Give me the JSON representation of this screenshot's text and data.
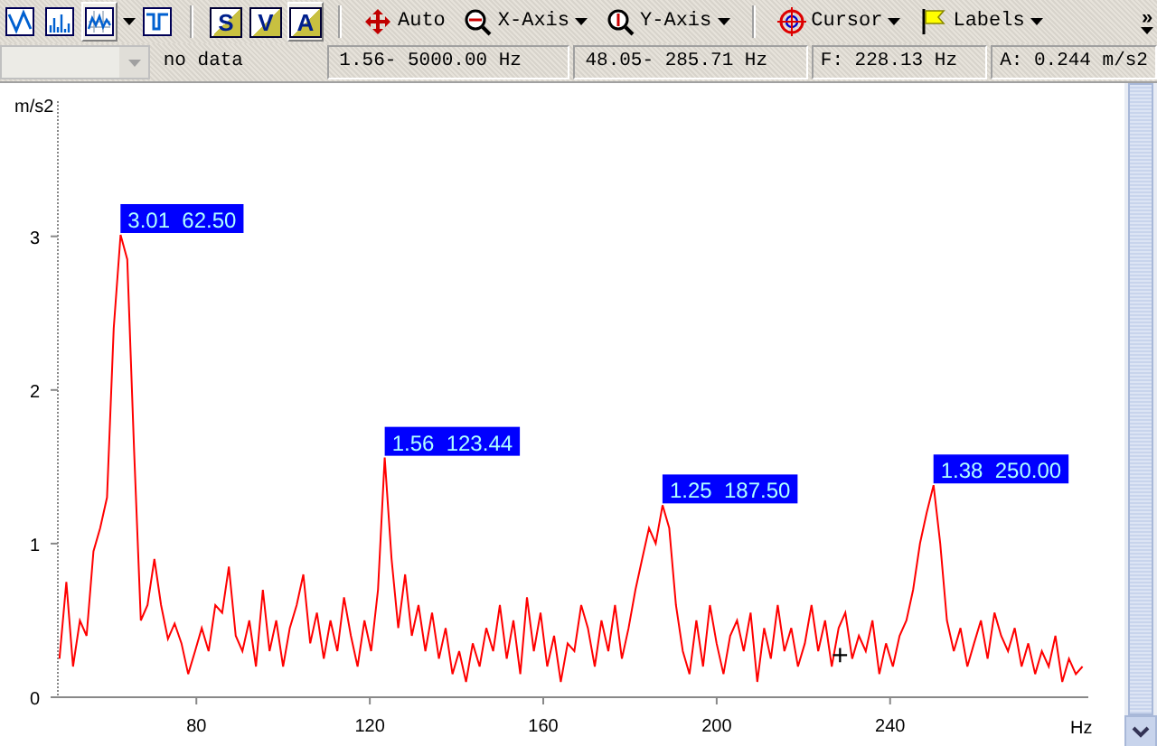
{
  "toolbar": {
    "items": [
      {
        "kind": "toggle",
        "selected": false
      },
      {
        "kind": "toggle",
        "selected": false
      },
      {
        "kind": "toggle",
        "selected": true,
        "dropdown": true
      },
      {
        "kind": "toggle",
        "selected": false
      },
      {
        "kind": "separator"
      },
      {
        "kind": "letter",
        "text": "S",
        "selected": false
      },
      {
        "kind": "letter",
        "text": "V",
        "selected": false
      },
      {
        "kind": "letter",
        "text": "A",
        "selected": true
      },
      {
        "kind": "separator"
      },
      {
        "kind": "command",
        "label": "Auto"
      },
      {
        "kind": "command",
        "label": "X-Axis",
        "dropdown": true
      },
      {
        "kind": "command",
        "label": "Y-Axis",
        "dropdown": true
      },
      {
        "kind": "separator"
      },
      {
        "kind": "command",
        "label": "Cursor",
        "dropdown": true
      },
      {
        "kind": "command",
        "label": "Labels",
        "dropdown": true
      },
      {
        "kind": "overflow",
        "text": "»"
      }
    ]
  },
  "status_bar": {
    "combo": {
      "disabled": true
    },
    "fields": [
      "no data",
      "1.56- 5000.00 Hz",
      "48.05- 285.71 Hz",
      "F: 228.13 Hz",
      "A: 0.244 m/s2"
    ]
  },
  "plot": {
    "chart_data": {
      "type": "line",
      "xlabel": "Hz",
      "ylabel": "m/s2",
      "xlim": [
        48.05,
        285.71
      ],
      "ylim": [
        0,
        3.88
      ],
      "xticks": [
        80,
        120,
        160,
        200,
        240
      ],
      "yticks": [
        0,
        1,
        2,
        3
      ],
      "x": [
        48.4375,
        50,
        51.5625,
        53.125,
        54.6875,
        56.25,
        57.8125,
        59.375,
        60.9375,
        62.5,
        64.0625,
        65.625,
        67.1875,
        68.75,
        70.3125,
        71.875,
        73.4375,
        75,
        76.5625,
        78.125,
        79.6875,
        81.25,
        82.8125,
        84.375,
        85.9375,
        87.5,
        89.0625,
        90.625,
        92.1875,
        93.75,
        95.3125,
        96.875,
        98.4375,
        100,
        101.5625,
        103.125,
        104.6875,
        106.25,
        107.8125,
        109.375,
        110.9375,
        112.5,
        114.0625,
        115.625,
        117.1875,
        118.75,
        120.3125,
        121.875,
        123.4375,
        125,
        126.5625,
        128.125,
        129.6875,
        131.25,
        132.8125,
        134.375,
        135.9375,
        137.5,
        139.0625,
        140.625,
        142.1875,
        143.75,
        145.3125,
        146.875,
        148.4375,
        150,
        151.5625,
        153.125,
        154.6875,
        156.25,
        157.8125,
        159.375,
        160.9375,
        162.5,
        164.0625,
        165.625,
        167.1875,
        168.75,
        170.3125,
        171.875,
        173.4375,
        175,
        176.5625,
        178.125,
        179.6875,
        181.25,
        182.8125,
        184.375,
        185.9375,
        187.5,
        189.0625,
        190.625,
        192.1875,
        193.75,
        195.3125,
        196.875,
        198.4375,
        200,
        201.5625,
        203.125,
        204.6875,
        206.25,
        207.8125,
        209.375,
        210.9375,
        212.5,
        214.0625,
        215.625,
        217.1875,
        218.75,
        220.3125,
        221.875,
        223.4375,
        225,
        226.5625,
        228.125,
        229.6875,
        231.25,
        232.8125,
        234.375,
        235.9375,
        237.5,
        239.0625,
        240.625,
        242.1875,
        243.75,
        245.3125,
        246.875,
        248.4375,
        250,
        251.5625,
        253.125,
        254.6875,
        256.25,
        257.8125,
        259.375,
        260.9375,
        262.5,
        264.0625,
        265.625,
        267.1875,
        268.75,
        270.3125,
        271.875,
        273.4375,
        275,
        276.5625,
        278.125,
        279.6875,
        281.25,
        282.8125,
        284.375
      ],
      "series": [
        {
          "color": "#ff0000",
          "values": [
            0.25,
            0.75,
            0.2,
            0.5,
            0.4,
            0.95,
            1.1,
            1.3,
            2.4,
            3.01,
            2.85,
            1.6,
            0.5,
            0.6,
            0.9,
            0.6,
            0.38,
            0.48,
            0.35,
            0.15,
            0.3,
            0.45,
            0.3,
            0.6,
            0.55,
            0.85,
            0.4,
            0.3,
            0.5,
            0.2,
            0.7,
            0.3,
            0.5,
            0.2,
            0.45,
            0.6,
            0.8,
            0.35,
            0.55,
            0.25,
            0.5,
            0.3,
            0.65,
            0.4,
            0.2,
            0.5,
            0.3,
            0.7,
            1.56,
            0.9,
            0.45,
            0.8,
            0.4,
            0.6,
            0.3,
            0.55,
            0.25,
            0.45,
            0.15,
            0.3,
            0.1,
            0.35,
            0.2,
            0.45,
            0.3,
            0.6,
            0.25,
            0.5,
            0.15,
            0.65,
            0.3,
            0.55,
            0.2,
            0.4,
            0.1,
            0.35,
            0.3,
            0.6,
            0.45,
            0.2,
            0.5,
            0.3,
            0.6,
            0.25,
            0.45,
            0.7,
            0.9,
            1.1,
            1.0,
            1.25,
            1.1,
            0.6,
            0.3,
            0.15,
            0.5,
            0.2,
            0.6,
            0.35,
            0.15,
            0.4,
            0.5,
            0.3,
            0.55,
            0.1,
            0.45,
            0.25,
            0.6,
            0.3,
            0.45,
            0.2,
            0.35,
            0.6,
            0.3,
            0.5,
            0.2,
            0.45,
            0.55,
            0.25,
            0.4,
            0.3,
            0.5,
            0.15,
            0.35,
            0.2,
            0.4,
            0.5,
            0.7,
            1.0,
            1.2,
            1.38,
            1.0,
            0.5,
            0.3,
            0.45,
            0.2,
            0.35,
            0.5,
            0.25,
            0.55,
            0.4,
            0.3,
            0.45,
            0.2,
            0.35,
            0.15,
            0.3,
            0.2,
            0.4,
            0.1,
            0.25,
            0.15,
            0.2
          ]
        }
      ],
      "annotations": [
        {
          "x": 62.5,
          "y": 3.01,
          "text": "3.01  62.50"
        },
        {
          "x": 123.44,
          "y": 1.56,
          "text": "1.56  123.44"
        },
        {
          "x": 187.5,
          "y": 1.25,
          "text": "1.25  187.50"
        },
        {
          "x": 250,
          "y": 1.38,
          "text": "1.38  250.00"
        }
      ]
    },
    "cursor": {
      "text": "+"
    }
  }
}
